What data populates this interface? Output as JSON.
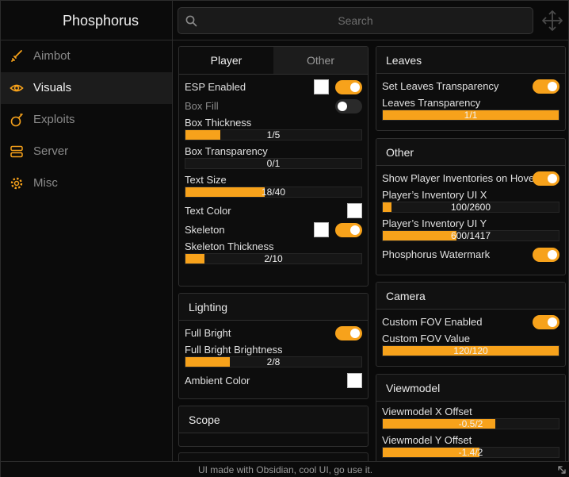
{
  "app": {
    "title": "Phosphorus"
  },
  "sidebar": {
    "items": [
      {
        "label": "Aimbot",
        "icon": "sword-icon"
      },
      {
        "label": "Visuals",
        "icon": "eye-icon",
        "active": true
      },
      {
        "label": "Exploits",
        "icon": "bomb-icon"
      },
      {
        "label": "Server",
        "icon": "server-icon"
      },
      {
        "label": "Misc",
        "icon": "gear-icon"
      }
    ]
  },
  "search": {
    "placeholder": "Search",
    "value": ""
  },
  "player_panel": {
    "tabs": [
      {
        "label": "Player",
        "active": true
      },
      {
        "label": "Other",
        "active": false
      }
    ],
    "esp_enabled": {
      "label": "ESP Enabled",
      "color": "#ffffff",
      "on": true
    },
    "box_fill": {
      "label": "Box Fill",
      "on": false
    },
    "box_thickness": {
      "label": "Box Thickness",
      "value": "1/5",
      "fraction": 0.2
    },
    "box_transparency": {
      "label": "Box Transparency",
      "value": "0/1",
      "fraction": 0
    },
    "text_size": {
      "label": "Text Size",
      "value": "18/40",
      "fraction": 0.45
    },
    "text_color": {
      "label": "Text Color",
      "color": "#ffffff"
    },
    "skeleton": {
      "label": "Skeleton",
      "color": "#ffffff",
      "on": true
    },
    "skeleton_thickness": {
      "label": "Skeleton Thickness",
      "value": "2/10",
      "fraction": 0.11
    }
  },
  "lighting_panel": {
    "title": "Lighting",
    "full_bright": {
      "label": "Full Bright",
      "on": true
    },
    "full_bright_brightness": {
      "label": "Full Bright Brightness",
      "value": "2/8",
      "fraction": 0.25
    },
    "ambient_color": {
      "label": "Ambient Color",
      "color": "#ffffff"
    }
  },
  "scope_panel": {
    "title": "Scope"
  },
  "leaves_panel": {
    "title": "Leaves",
    "set_transparency": {
      "label": "Set Leaves Transparency",
      "on": true
    },
    "transparency": {
      "label": "Leaves Transparency",
      "value": "1/1",
      "fraction": 1
    }
  },
  "other_panel": {
    "title": "Other",
    "show_inventories": {
      "label": "Show Player Inventories on Hover",
      "on": true
    },
    "inventory_x": {
      "label": "Player’s Inventory UI X",
      "value": "100/2600",
      "fraction": 0.05
    },
    "inventory_y": {
      "label": "Player’s Inventory UI Y",
      "value": "600/1417",
      "fraction": 0.42
    },
    "watermark": {
      "label": "Phosphorus Watermark",
      "on": true
    }
  },
  "camera_panel": {
    "title": "Camera",
    "custom_fov_enabled": {
      "label": "Custom FOV Enabled",
      "on": true
    },
    "custom_fov_value": {
      "label": "Custom FOV Value",
      "value": "120/120",
      "fraction": 1
    }
  },
  "viewmodel_panel": {
    "title": "Viewmodel",
    "x_offset": {
      "label": "Viewmodel X Offset",
      "value": "-0.5/2",
      "fraction": 0.64
    },
    "y_offset": {
      "label": "Viewmodel Y Offset",
      "value": "-1.4/2",
      "fraction": 0.55
    }
  },
  "footer": {
    "text": "UI made with Obsidian, cool UI, go use it."
  },
  "colors": {
    "accent": "#f7a21b",
    "background": "#0a0a0a",
    "panel": "#0d0d0d",
    "border": "#2f2f2f"
  }
}
